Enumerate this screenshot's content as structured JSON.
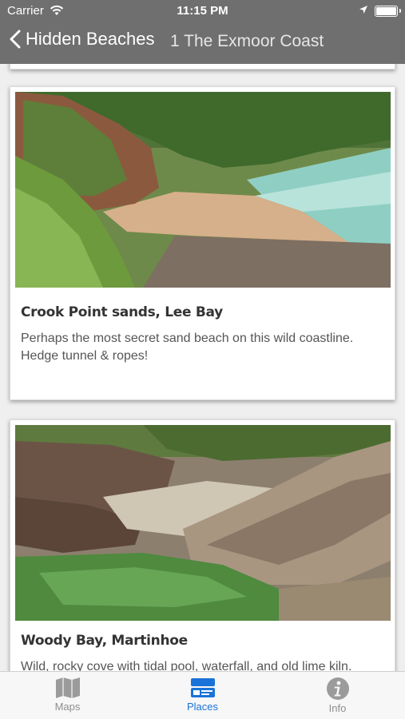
{
  "status_bar": {
    "carrier": "Carrier",
    "time": "11:15 PM"
  },
  "nav": {
    "back_label": "Hidden Beaches",
    "title": "1 The Exmoor Coast"
  },
  "cards": [
    {
      "title": "Crook Point sands, Lee Bay",
      "description": "Perhaps the most secret sand beach on this wild coastline. Hedge tunnel & ropes!"
    },
    {
      "title": "Woody Bay, Martinhoe",
      "description": "Wild, rocky cove with tidal pool, waterfall, and old lime kiln."
    }
  ],
  "tabs": [
    {
      "label": "Maps",
      "icon": "map-icon"
    },
    {
      "label": "Places",
      "icon": "places-icon"
    },
    {
      "label": "Info",
      "icon": "info-icon"
    }
  ],
  "colors": {
    "nav_bg": "#6f6f6f",
    "active_tab": "#1a73d9",
    "inactive_tab": "#8e8e8e"
  }
}
